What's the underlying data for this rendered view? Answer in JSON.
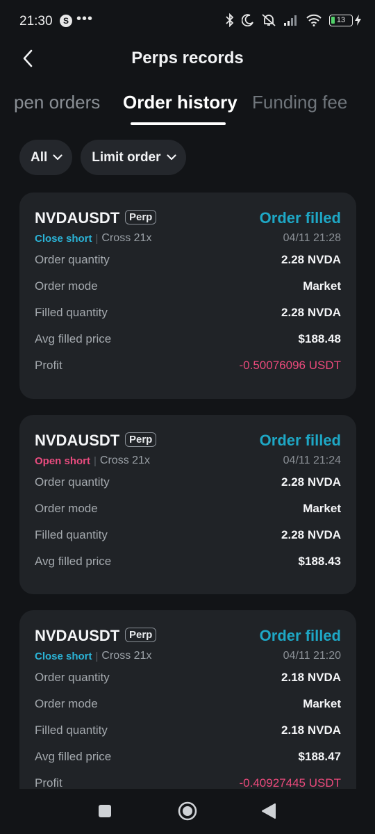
{
  "status_bar": {
    "time": "21:30",
    "app_icon_letter": "S",
    "dots": "•••",
    "battery": "13",
    "icons": [
      "bluetooth-icon",
      "moon-icon",
      "bell-off-icon",
      "signal-icon",
      "wifi-icon",
      "battery-icon",
      "charging-icon"
    ]
  },
  "header": {
    "title": "Perps records",
    "back_icon": "chevron-left-icon"
  },
  "tabs": [
    {
      "label": "Open orders",
      "visible_text": "pen orders"
    },
    {
      "label": "Order history",
      "active": true
    },
    {
      "label": "Funding fee"
    }
  ],
  "filters": {
    "scope": "All",
    "type": "Limit order"
  },
  "orders": [
    {
      "symbol": "NVDAUSDT",
      "badge": "Perp",
      "status": "Order filled",
      "side": "Close short",
      "side_type": "close",
      "leverage": "Cross 21x",
      "datetime": "04/11 21:28",
      "rows": [
        {
          "label": "Order quantity",
          "value": "2.28 NVDA"
        },
        {
          "label": "Order mode",
          "value": "Market"
        },
        {
          "label": "Filled quantity",
          "value": "2.28 NVDA"
        },
        {
          "label": "Avg filled price",
          "value": "$188.48"
        },
        {
          "label": "Profit",
          "value": "-0.50076096 USDT",
          "negative": true
        }
      ]
    },
    {
      "symbol": "NVDAUSDT",
      "badge": "Perp",
      "status": "Order filled",
      "side": "Open short",
      "side_type": "open",
      "leverage": "Cross 21x",
      "datetime": "04/11 21:24",
      "rows": [
        {
          "label": "Order quantity",
          "value": "2.28 NVDA"
        },
        {
          "label": "Order mode",
          "value": "Market"
        },
        {
          "label": "Filled quantity",
          "value": "2.28 NVDA"
        },
        {
          "label": "Avg filled price",
          "value": "$188.43"
        }
      ]
    },
    {
      "symbol": "NVDAUSDT",
      "badge": "Perp",
      "status": "Order filled",
      "side": "Close short",
      "side_type": "close",
      "leverage": "Cross 21x",
      "datetime": "04/11 21:20",
      "rows": [
        {
          "label": "Order quantity",
          "value": "2.18 NVDA"
        },
        {
          "label": "Order mode",
          "value": "Market"
        },
        {
          "label": "Filled quantity",
          "value": "2.18 NVDA"
        },
        {
          "label": "Avg filled price",
          "value": "$188.47"
        },
        {
          "label": "Profit",
          "value": "-0.40927445 USDT",
          "negative": true
        }
      ]
    }
  ],
  "colors": {
    "background": "#121417",
    "card": "#202327",
    "accent_cyan": "#1ea7c5",
    "negative_pink": "#ec4a7c"
  },
  "nav_bar": {
    "buttons": [
      "recents-square-icon",
      "home-circle-icon",
      "back-triangle-icon"
    ]
  }
}
